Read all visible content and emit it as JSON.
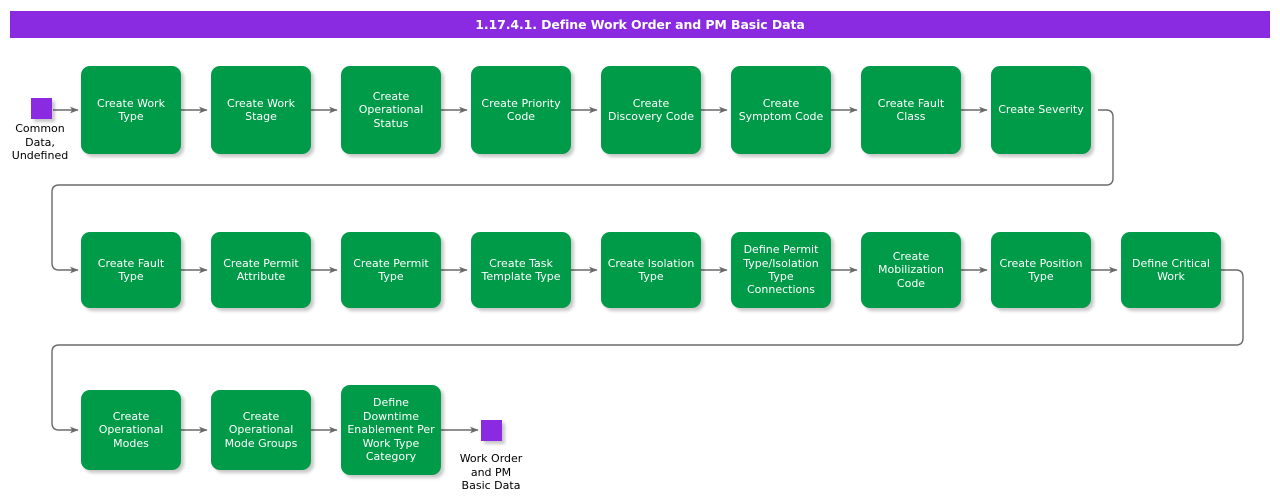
{
  "title": {
    "text": "1.17.4.1. Define Work Order and PM Basic Data",
    "bar_color": "#8a2be2"
  },
  "colors": {
    "process_fill": "#009b48",
    "terminator_fill": "#8a2be2",
    "connector": "#6a6a6a",
    "text_on_process": "#ffffff",
    "text_on_canvas": "#000000",
    "canvas": "#ffffff"
  },
  "start_node": {
    "name": "common-data-undefined",
    "label": "Common\nData,\nUndefined"
  },
  "end_node": {
    "name": "work-order-and-pm-basic-data",
    "label": "Work Order\nand PM\nBasic Data"
  },
  "rows": [
    {
      "row": 1,
      "nodes": [
        {
          "id": "create-work-type",
          "label": "Create Work\nType"
        },
        {
          "id": "create-work-stage",
          "label": "Create Work\nStage"
        },
        {
          "id": "create-operational-status",
          "label": "Create\nOperational\nStatus"
        },
        {
          "id": "create-priority-code",
          "label": "Create Priority\nCode"
        },
        {
          "id": "create-discovery-code",
          "label": "Create\nDiscovery Code"
        },
        {
          "id": "create-symptom-code",
          "label": "Create\nSymptom Code"
        },
        {
          "id": "create-fault-class",
          "label": "Create Fault\nClass"
        },
        {
          "id": "create-severity",
          "label": "Create Severity"
        }
      ]
    },
    {
      "row": 2,
      "nodes": [
        {
          "id": "create-fault-type",
          "label": "Create Fault\nType"
        },
        {
          "id": "create-permit-attribute",
          "label": "Create Permit\nAttribute"
        },
        {
          "id": "create-permit-type",
          "label": "Create Permit\nType"
        },
        {
          "id": "create-task-template-type",
          "label": "Create Task\nTemplate Type"
        },
        {
          "id": "create-isolation-type",
          "label": "Create Isolation\nType"
        },
        {
          "id": "define-permit-type-isolation-type-connections",
          "label": "Define Permit\nType/Isolation\nType\nConnections"
        },
        {
          "id": "create-mobilization-code",
          "label": "Create\nMobilization\nCode"
        },
        {
          "id": "create-position-type",
          "label": "Create Position\nType"
        },
        {
          "id": "define-critical-work",
          "label": "Define Critical\nWork"
        }
      ]
    },
    {
      "row": 3,
      "nodes": [
        {
          "id": "create-operational-modes",
          "label": "Create\nOperational\nModes"
        },
        {
          "id": "create-operational-mode-groups",
          "label": "Create\nOperational\nMode Groups"
        },
        {
          "id": "define-downtime-enablement-per-work-type-category",
          "label": "Define\nDowntime\nEnablement Per\nWork Type\nCategory"
        }
      ]
    }
  ]
}
